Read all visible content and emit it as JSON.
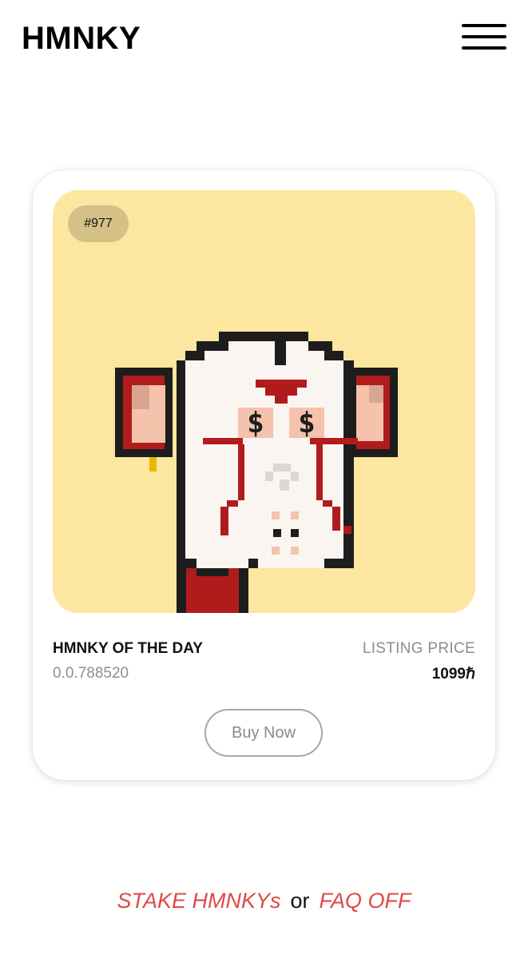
{
  "header": {
    "logo": "HMNKY"
  },
  "card": {
    "badge": "#977",
    "title": "HMNKY OF THE DAY",
    "token_id": "0.0.788520",
    "price_label": "LISTING PRICE",
    "price_value": "1099ℏ",
    "buy_button": "Buy Now",
    "art_background": "#fce6a0"
  },
  "footer": {
    "link1": "STAKE HMNKYs",
    "separator": "or",
    "link2": "FAQ OFF",
    "link_color": "#e04848"
  },
  "icons": {
    "menu": "hamburger-menu-icon"
  }
}
